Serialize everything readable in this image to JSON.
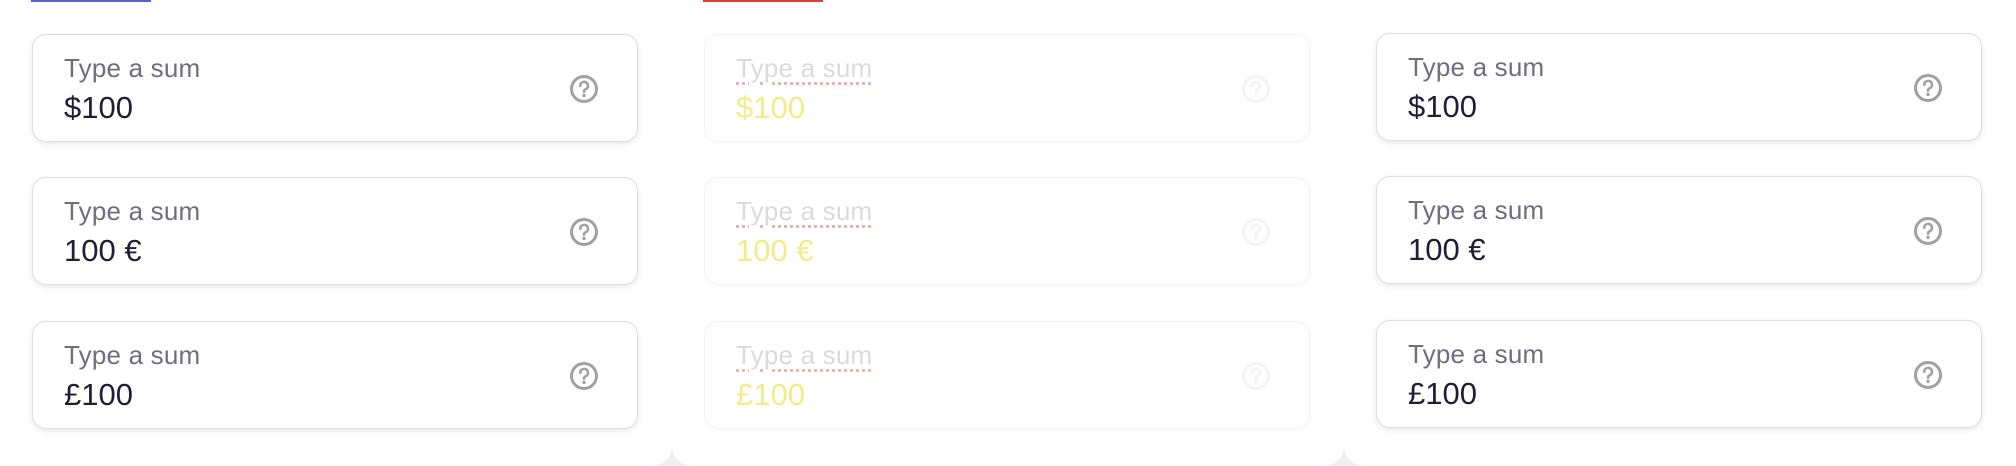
{
  "colors": {
    "accent_left": "#5a5fcf",
    "accent_middle": "#e13c3c",
    "help_icon": "#a0a0aa"
  },
  "icons": {
    "help": "question-circle-icon"
  },
  "columns": [
    {
      "fields": [
        {
          "label": "Type a sum",
          "value": "$100"
        },
        {
          "label": "Type a sum",
          "value": "100 €"
        },
        {
          "label": "Type a sum",
          "value": "£100"
        }
      ]
    },
    {
      "fields": [
        {
          "label": "Type a sum",
          "value": "$100"
        },
        {
          "label": "Type a sum",
          "value": "100 €"
        },
        {
          "label": "Type a sum",
          "value": "£100"
        }
      ]
    },
    {
      "fields": [
        {
          "label": "Type a sum",
          "value": "$100"
        },
        {
          "label": "Type a sum",
          "value": "100 €"
        },
        {
          "label": "Type a sum",
          "value": "£100"
        }
      ]
    }
  ]
}
